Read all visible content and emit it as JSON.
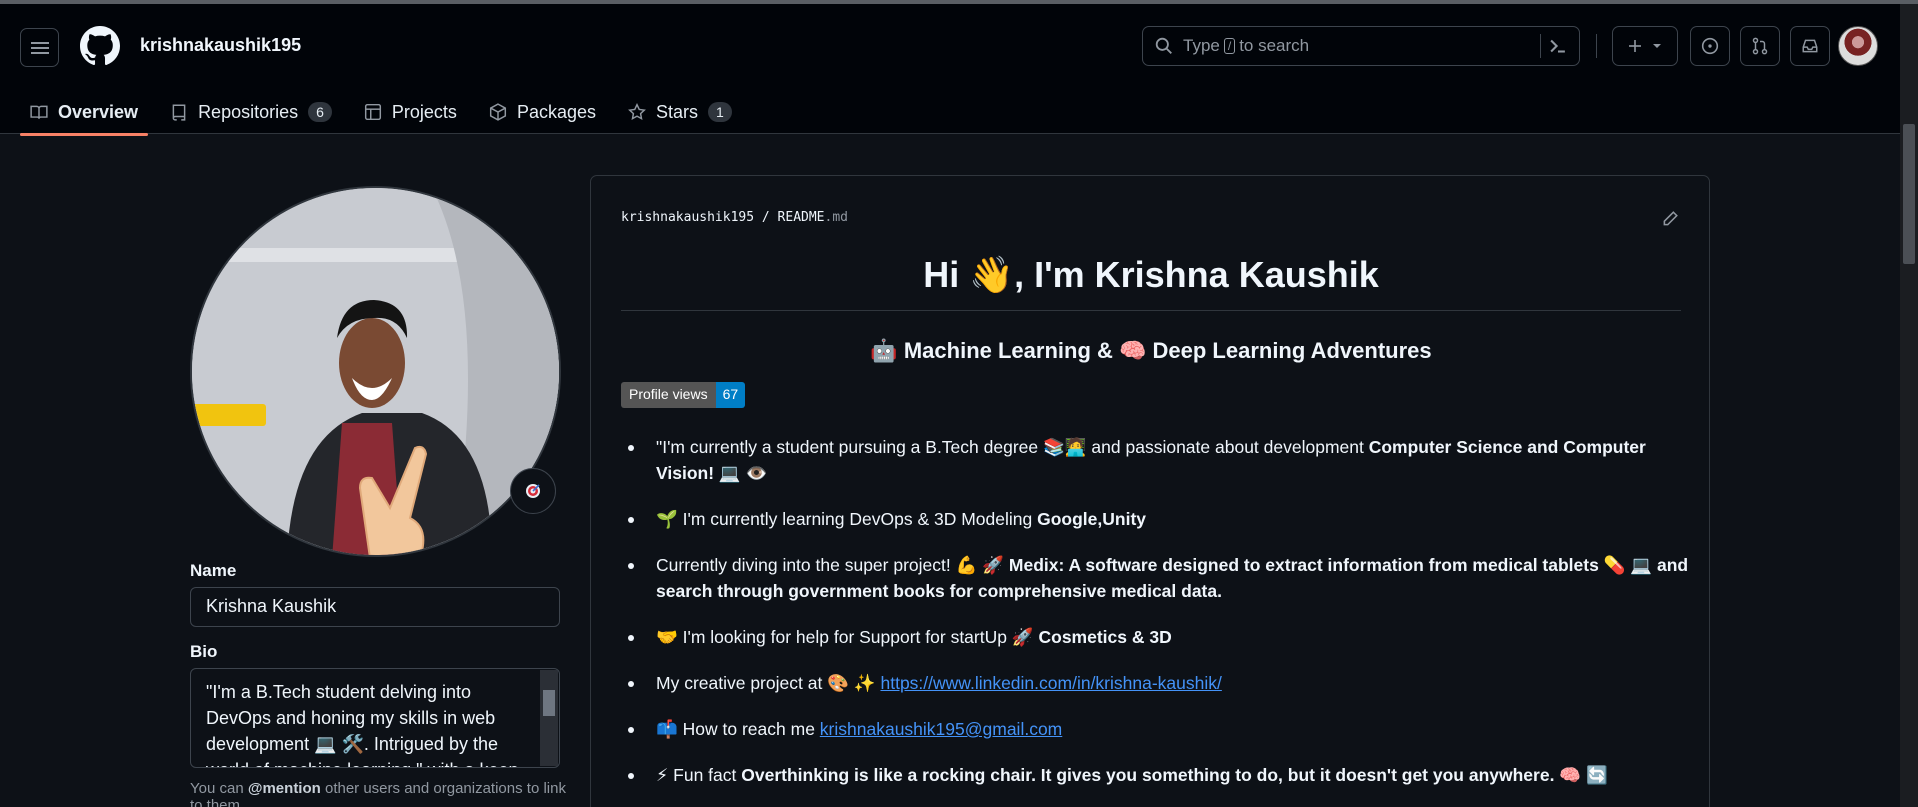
{
  "header": {
    "username": "krishnakaushik195",
    "search_prefix": "Type",
    "search_key": "/",
    "search_suffix": "to search"
  },
  "tabs": [
    {
      "label": "Overview"
    },
    {
      "label": "Repositories",
      "count": "6"
    },
    {
      "label": "Projects"
    },
    {
      "label": "Packages"
    },
    {
      "label": "Stars",
      "count": "1"
    }
  ],
  "profile": {
    "name_label": "Name",
    "name_value": "Krishna Kaushik",
    "bio_label": "Bio",
    "bio_value": "\"I'm a B.Tech student delving into DevOps and honing my skills in web development 💻 🛠️. Intrigued by the world of machine learning,\" with a keen",
    "hint_pre": "You can",
    "hint_mention": "@mention",
    "hint_post": "other users and organizations to link to them."
  },
  "readme": {
    "repo": "krishnakaushik195",
    "sep": "/",
    "file": "README",
    "ext": ".md",
    "title": "Hi 👋, I'm Krishna Kaushik",
    "subtitle": "🤖 Machine Learning & 🧠 Deep Learning Adventures",
    "badge_label": "Profile views",
    "badge_count": "67",
    "items": [
      {
        "pre": "\"I'm currently a student pursuing a B.Tech degree 📚🧑‍💻 and passionate about development ",
        "bold": "Computer Science and Computer Vision! 💻 👁️"
      },
      {
        "pre": "🌱 I'm currently learning DevOps & 3D Modeling ",
        "bold": "Google,Unity"
      },
      {
        "pre": "Currently diving into the super project! 💪 🚀 ",
        "bold": "Medix: A software designed to extract information from medical tablets 💊 💻 and search through government books for comprehensive medical data."
      },
      {
        "pre": "🤝 I'm looking for help for Support for startUp 🚀 ",
        "bold": "Cosmetics & 3D"
      },
      {
        "pre": "My creative project at 🎨 ✨ ",
        "link": "https://www.linkedin.com/in/krishna-kaushik/"
      },
      {
        "pre": "📫 How to reach me ",
        "link": "krishnakaushik195@gmail.com"
      },
      {
        "pre": "⚡ Fun fact ",
        "bold": "Overthinking is like a rocking chair. It gives you something to do, but it doesn't get you anywhere. 🧠 🔄"
      }
    ]
  }
}
